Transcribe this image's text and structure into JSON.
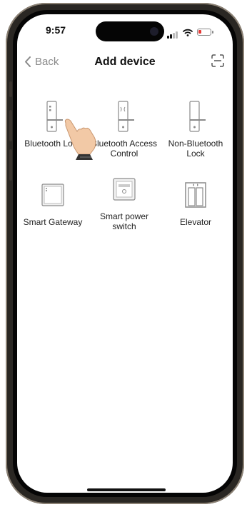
{
  "status": {
    "time": "9:57"
  },
  "nav": {
    "back_label": "Back",
    "title": "Add device"
  },
  "devices": [
    {
      "label": "Bluetooth Lock",
      "icon": "door-lock-icon"
    },
    {
      "label": "Bluetooth Access Control",
      "icon": "access-control-icon"
    },
    {
      "label": "Non-Bluetooth Lock",
      "icon": "door-lock-icon"
    },
    {
      "label": "Smart Gateway",
      "icon": "gateway-icon"
    },
    {
      "label": "Smart power switch",
      "icon": "power-switch-icon"
    },
    {
      "label": "Elevator",
      "icon": "elevator-icon"
    }
  ],
  "colors": {
    "accent_gray": "#8a8a8a",
    "battery_low": "#e53935"
  }
}
